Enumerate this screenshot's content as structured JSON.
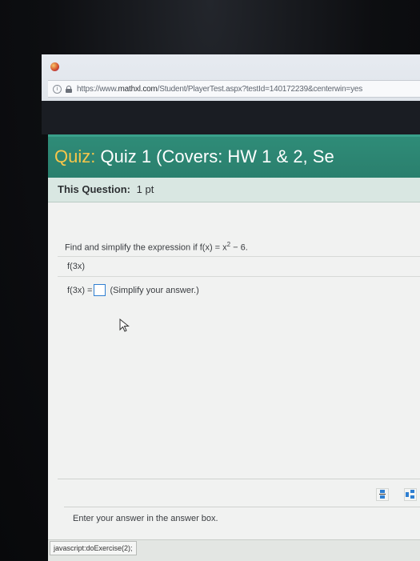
{
  "browser": {
    "url_prefix": "https://www.",
    "url_domain": "mathxl.com",
    "url_path": "/Student/PlayerTest.aspx?testId=140172239&centerwin=yes"
  },
  "quiz": {
    "label": "Quiz:",
    "title": "Quiz 1 (Covers: HW 1 & 2, Se"
  },
  "question": {
    "label": "This Question:",
    "points": "1 pt",
    "prompt_text": "Find and simplify the expression if f(x) = x",
    "prompt_exponent": "2",
    "prompt_tail": " − 6.",
    "expression": "f(3x)",
    "answer_label": "f(3x) =",
    "answer_value": "",
    "hint": "(Simplify your answer.)"
  },
  "footer": {
    "instruction": "Enter your answer in the answer box.",
    "status_link": "javascript:doExercise(2);"
  },
  "colors": {
    "header_bg": "#2f8c78",
    "quiz_label": "#f7c64a",
    "answer_box_border": "#2f7fd1"
  }
}
